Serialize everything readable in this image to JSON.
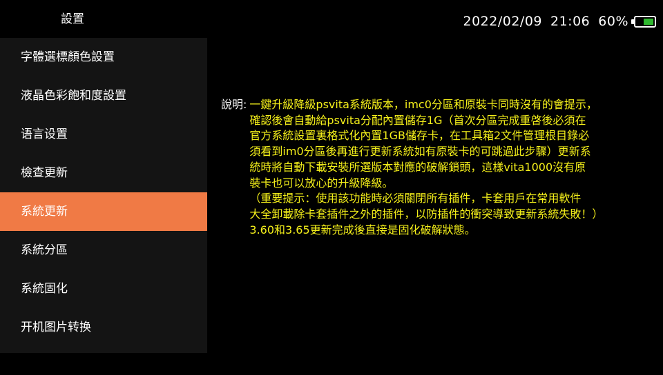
{
  "header": {
    "title": "設置"
  },
  "status": {
    "date": "2022/02/09",
    "time": "21:06",
    "battery_pct": "60%",
    "battery_level": 0.6,
    "battery_color": "#2fb82f"
  },
  "sidebar": {
    "items": [
      {
        "label": "字體選標顏色設置",
        "active": false
      },
      {
        "label": "液晶色彩飽和度設置",
        "active": false
      },
      {
        "label": "语言设置",
        "active": false
      },
      {
        "label": "檢查更新",
        "active": false
      },
      {
        "label": "系統更新",
        "active": true
      },
      {
        "label": "系統分區",
        "active": false
      },
      {
        "label": "系統固化",
        "active": false
      },
      {
        "label": "开机图片转换",
        "active": false
      }
    ],
    "active_color": "#f07a45"
  },
  "description": {
    "label": "說明:",
    "lines": [
      "一鍵升級降級psvita系統版本，imc0分區和原裝卡同時沒有的會提示，",
      "確認後會自動給psvita分配內置儲存1G（首次分區完成重啓後必須在",
      "官方系統設置裏格式化內置1GB儲存卡，在工具箱2文件管理根目錄必",
      "須看到im0分區後再進行更新系統如有原裝卡的可跳過此步驟）更新系",
      "統時將自動下載安裝所選版本對應的破解鎖頭，這樣vita1000沒有原",
      "裝卡也可以放心的升級降級。",
      "（重要提示：使用該功能時必須關閉所有插件，卡套用戶在常用軟件",
      "大全卸載除卡套插件之外的插件，以防插件的衝突導致更新系統失敗！）",
      "3.60和3.65更新完成後直接是固化破解狀態。"
    ],
    "text_color": "#f5f01a"
  }
}
